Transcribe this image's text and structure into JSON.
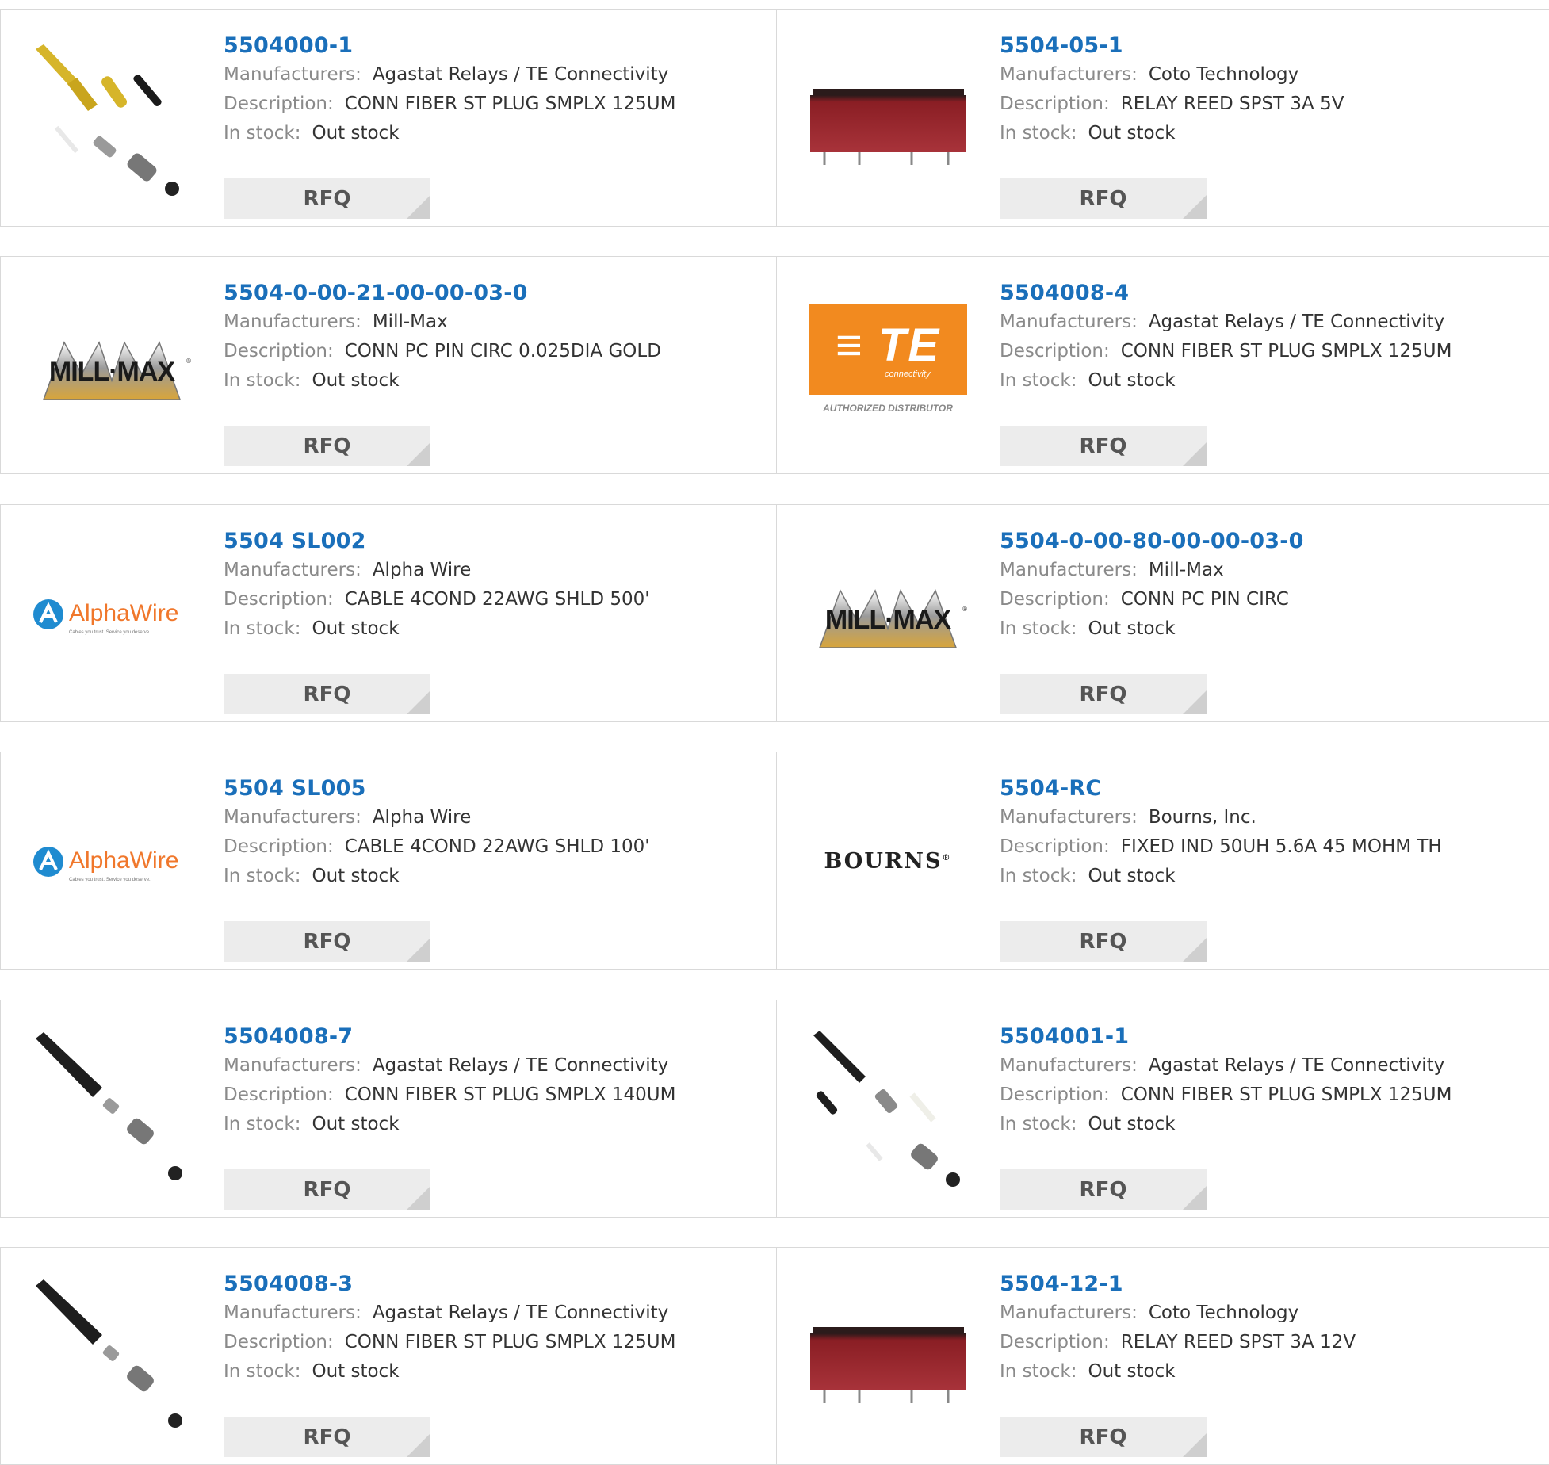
{
  "labels": {
    "manufacturers": "Manufacturers:",
    "description": "Description:",
    "in_stock": "In stock:",
    "rfq": "RFQ"
  },
  "colors": {
    "link": "#1a6fba",
    "label": "#8a8a8a",
    "button_bg": "#ececec"
  },
  "products": [
    {
      "part": "5504000-1",
      "manufacturer": "Agastat Relays / TE Connectivity",
      "description": "CONN FIBER ST PLUG SMPLX 125UM",
      "stock": "Out stock",
      "image": "fiber-connector-kit-yellow"
    },
    {
      "part": "5504-05-1",
      "manufacturer": "Coto Technology",
      "description": "RELAY REED SPST 3A 5V",
      "stock": "Out stock",
      "image": "reed-relay-red"
    },
    {
      "part": "5504-0-00-21-00-00-03-0",
      "manufacturer": "Mill-Max",
      "description": "CONN PC PIN CIRC 0.025DIA GOLD",
      "stock": "Out stock",
      "image": "mill-max-logo"
    },
    {
      "part": "5504008-4",
      "manufacturer": "Agastat Relays / TE Connectivity",
      "description": "CONN FIBER ST PLUG SMPLX 125UM",
      "stock": "Out stock",
      "image": "te-logo",
      "logo_text": "TE",
      "logo_sub": "connectivity",
      "logo_caption": "AUTHORIZED DISTRIBUTOR"
    },
    {
      "part": "5504 SL002",
      "manufacturer": "Alpha Wire",
      "description": "CABLE 4COND 22AWG SHLD 500'",
      "stock": "Out stock",
      "image": "alphawire-logo",
      "logo_text": "AlphaWire",
      "logo_sub": "Cables you trust. Service you deserve."
    },
    {
      "part": "5504-0-00-80-00-00-03-0",
      "manufacturer": "Mill-Max",
      "description": "CONN PC PIN CIRC",
      "stock": "Out stock",
      "image": "mill-max-logo"
    },
    {
      "part": "5504 SL005",
      "manufacturer": "Alpha Wire",
      "description": "CABLE 4COND 22AWG SHLD 100'",
      "stock": "Out stock",
      "image": "alphawire-logo",
      "logo_text": "AlphaWire",
      "logo_sub": "Cables you trust. Service you deserve."
    },
    {
      "part": "5504-RC",
      "manufacturer": "Bourns, Inc.",
      "description": "FIXED IND 50UH 5.6A 45 MOHM TH",
      "stock": "Out stock",
      "image": "bourns-logo",
      "logo_text": "BOURNS"
    },
    {
      "part": "5504008-7",
      "manufacturer": "Agastat Relays / TE Connectivity",
      "description": "CONN FIBER ST PLUG SMPLX 140UM",
      "stock": "Out stock",
      "image": "fiber-connector-black"
    },
    {
      "part": "5504001-1",
      "manufacturer": "Agastat Relays / TE Connectivity",
      "description": "CONN FIBER ST PLUG SMPLX 125UM",
      "stock": "Out stock",
      "image": "fiber-connector-kit-black"
    },
    {
      "part": "5504008-3",
      "manufacturer": "Agastat Relays / TE Connectivity",
      "description": "CONN FIBER ST PLUG SMPLX 125UM",
      "stock": "Out stock",
      "image": "fiber-connector-black"
    },
    {
      "part": "5504-12-1",
      "manufacturer": "Coto Technology",
      "description": "RELAY REED SPST 3A 12V",
      "stock": "Out stock",
      "image": "reed-relay-red"
    }
  ]
}
